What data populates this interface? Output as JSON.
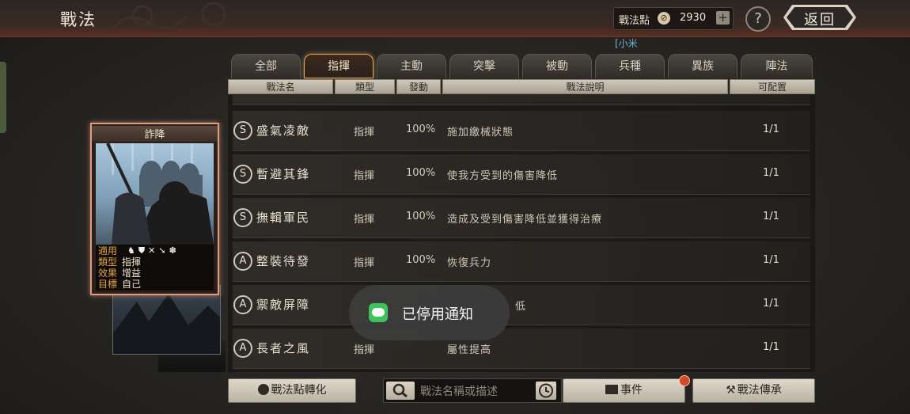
{
  "header": {
    "title": "戰法",
    "points_label": "戰法點",
    "points_value": "2930",
    "add_label": "+",
    "help_label": "?",
    "back_label": "返回"
  },
  "user_tag": "[小米",
  "tabs": [
    {
      "label": "全部",
      "active": false
    },
    {
      "label": "指揮",
      "active": true
    },
    {
      "label": "主動",
      "active": false
    },
    {
      "label": "突擊",
      "active": false
    },
    {
      "label": "被動",
      "active": false
    },
    {
      "label": "兵種",
      "active": false
    },
    {
      "label": "異族",
      "active": false
    },
    {
      "label": "陣法",
      "active": false
    }
  ],
  "table": {
    "headers": [
      "戰法名",
      "類型",
      "發動",
      "戰法說明",
      "可配置"
    ],
    "rows": [
      {
        "grade": "S",
        "name": "盛氣凌敵",
        "type": "指揮",
        "rate": "100%",
        "desc": "施加繳械狀態",
        "avail": "1/1"
      },
      {
        "grade": "S",
        "name": "暫避其鋒",
        "type": "指揮",
        "rate": "100%",
        "desc": "使我方受到的傷害降低",
        "avail": "1/1"
      },
      {
        "grade": "S",
        "name": "撫輯軍民",
        "type": "指揮",
        "rate": "100%",
        "desc": "造成及受到傷害降低並獲得治療",
        "avail": "1/1"
      },
      {
        "grade": "A",
        "name": "整裝待發",
        "type": "指揮",
        "rate": "100%",
        "desc": "恢復兵力",
        "avail": "1/1"
      },
      {
        "grade": "A",
        "name": "禦敵屏障",
        "type": "",
        "rate": "",
        "desc": "低",
        "avail": "1/1"
      },
      {
        "grade": "A",
        "name": "長者之風",
        "type": "指揮",
        "rate": "",
        "desc": "屬性提高",
        "avail": "1/1"
      }
    ]
  },
  "card": {
    "title": "詐降",
    "apply_label": "適用",
    "type_label": "類型",
    "type_value": "指揮",
    "effect_label": "效果",
    "effect_value": "增益",
    "target_label": "目標",
    "target_value": "自己",
    "unit_icons": [
      "cavalry-icon",
      "shield-icon",
      "bow-icon",
      "spear-icon",
      "siege-icon"
    ]
  },
  "bottom": {
    "convert_label": "戰法點轉化",
    "search_placeholder": "戰法名稱或描述",
    "events_label": "事件",
    "inherit_label": "戰法傳承"
  },
  "toast": {
    "text": "已停用通知",
    "icon": "line-app-icon"
  }
}
